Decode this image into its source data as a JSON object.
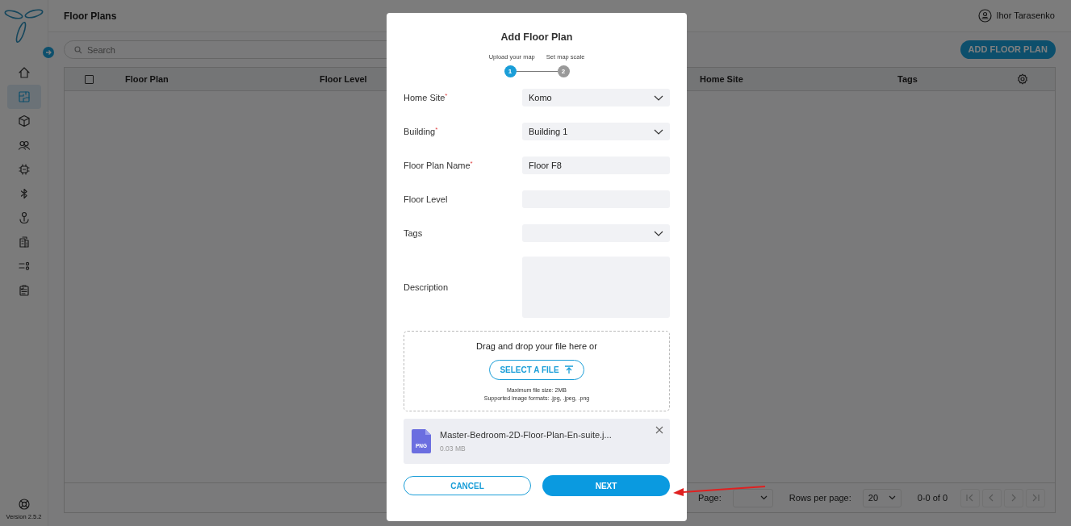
{
  "app": {
    "page_title": "Floor Plans",
    "user_name": "Ihor Tarasenko",
    "search": {
      "placeholder": "Search"
    },
    "add_button": "ADD FLOOR PLAN",
    "sidebar": {
      "items": [
        {
          "selected": false
        },
        {
          "selected": true
        },
        {
          "selected": false
        },
        {
          "selected": false
        },
        {
          "selected": false
        },
        {
          "selected": false
        },
        {
          "selected": false
        },
        {
          "selected": false
        },
        {
          "selected": false
        },
        {
          "selected": false
        }
      ],
      "version": "Version 2.5.2"
    },
    "table": {
      "select_all": {
        "checked": false
      },
      "columns": [
        {
          "label": "Floor Plan"
        },
        {
          "label": "Floor Level"
        },
        {
          "label": "Home Site"
        },
        {
          "label": "Tags"
        }
      ]
    },
    "pagination": {
      "page_label": "Page:",
      "rows_label": "Rows per page:",
      "rows_value": "20",
      "range": "0-0 of 0"
    }
  },
  "modal": {
    "title": "Add Floor Plan",
    "steps": [
      {
        "label": "Upload your map",
        "number": "1",
        "selected": true
      },
      {
        "label": "Set map scale",
        "number": "2",
        "selected": false
      }
    ],
    "fields": [
      {
        "label": "Home Site",
        "mark": "*",
        "kind": "select",
        "value": "Komo"
      },
      {
        "label": "Building",
        "mark": "*",
        "kind": "select",
        "value": "Building 1"
      },
      {
        "label": "Floor Plan Name",
        "mark": "*",
        "kind": "input",
        "value": "Floor F8"
      },
      {
        "label": "Floor Level",
        "kind": "input"
      },
      {
        "label": "Tags",
        "kind": "select"
      },
      {
        "label": "Description",
        "kind": "textarea"
      }
    ],
    "dropzone": {
      "prompt": "Drag and drop your file here or",
      "button": "SELECT A FILE",
      "notes": [
        "Maximum file size: 2MB",
        "Supported image formats: .jpg, .jpeg, .png"
      ]
    },
    "file": {
      "type": "PNG",
      "name": "Master-Bedroom-2D-Floor-Plan-En-suite.j...",
      "size": "0.03 MB"
    },
    "buttons": {
      "cancel": "CANCEL",
      "next": "NEXT"
    }
  }
}
